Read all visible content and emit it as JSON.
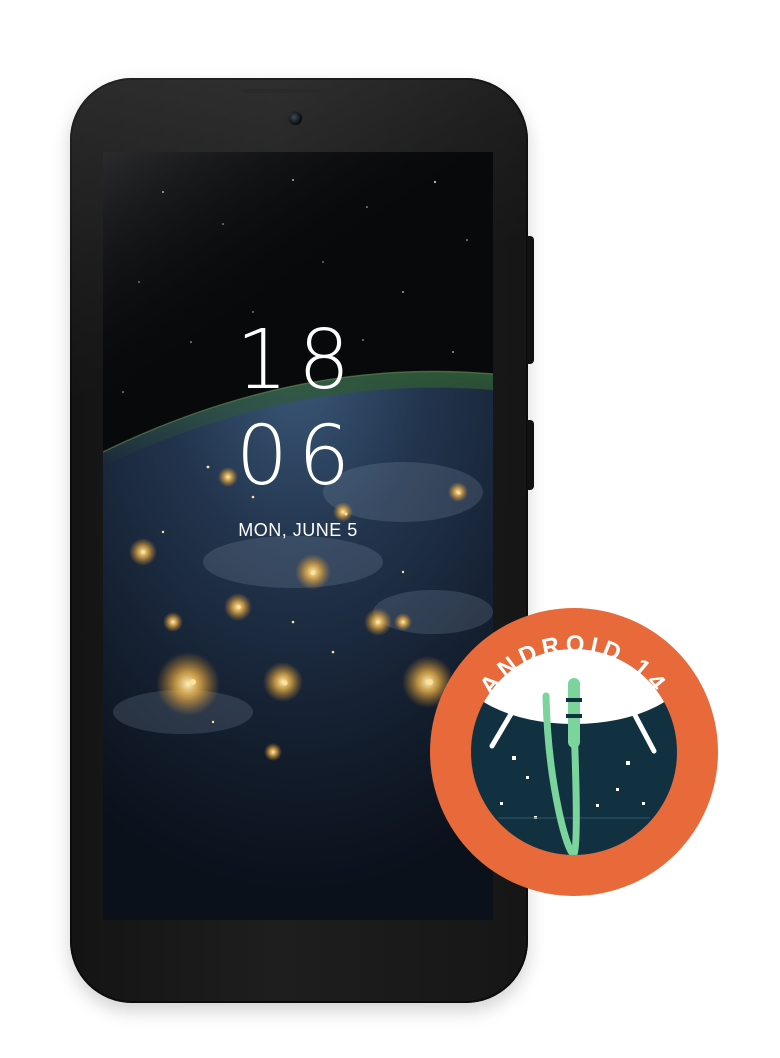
{
  "lockscreen": {
    "time_hours": "18",
    "time_minutes": "06",
    "date": "MON, JUNE 5"
  },
  "badge": {
    "text": "ANDROID 14",
    "colors": {
      "ring": "#e8693a",
      "space": "#123140",
      "dome": "#ffffff",
      "rocket": "#7bd49b"
    }
  },
  "icons": {
    "camera": "front-camera-icon",
    "badge": "android-14-badge"
  }
}
